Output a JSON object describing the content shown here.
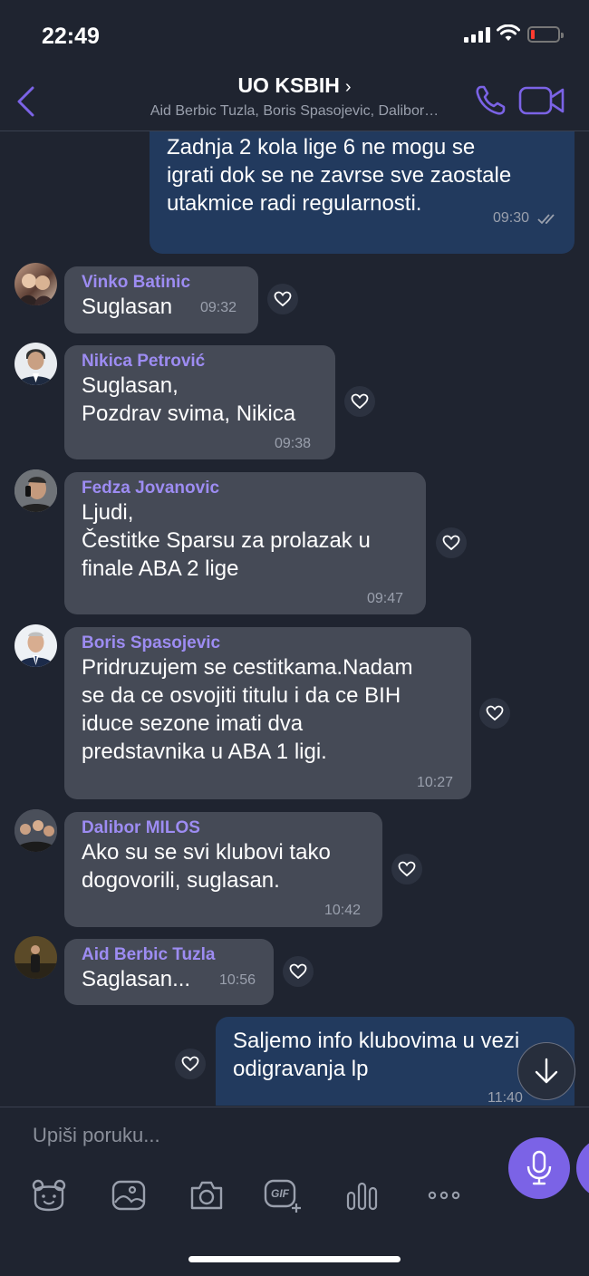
{
  "status_bar": {
    "time": "22:49"
  },
  "header": {
    "title": "UO KSBIH",
    "chevron": "›",
    "subtitle": "Aid Berbic Tuzla, Boris Spasojevic, Dalibor…"
  },
  "messages": [
    {
      "kind": "out",
      "text": "Zadnja 2 kola lige 6 ne mogu se\nigrati dok se ne zavrse sve zaostale\nutakmice radi regularnosti.",
      "time": "09:30"
    },
    {
      "kind": "in",
      "sender": "Vinko Batinic",
      "text": "Suglasan",
      "time": "09:32"
    },
    {
      "kind": "in",
      "sender": "Nikica Petrović",
      "text": "Suglasan,\nPozdrav svima, Nikica",
      "time": "09:38"
    },
    {
      "kind": "in",
      "sender": "Fedza Jovanovic",
      "text": "Ljudi,\nČestitke Sparsu za prolazak u\nfinale ABA 2 lige",
      "time": "09:47"
    },
    {
      "kind": "in",
      "sender": "Boris Spasojevic",
      "text": "Pridruzujem se cestitkama.Nadam\nse da ce osvojiti titulu  i da ce BIH\niduce sezone imati dva\npredstavnika u ABA 1 ligi.",
      "time": "10:27"
    },
    {
      "kind": "in",
      "sender": "Dalibor MILOS",
      "text": "Ako su se svi klubovi tako\ndogovorili, suglasan.",
      "time": "10:42"
    },
    {
      "kind": "in",
      "sender": "Aid Berbic Tuzla",
      "text": "Saglasan...",
      "time": "10:56"
    },
    {
      "kind": "out",
      "text": "Saljemo info klubovima u vezi\nodigravanja lp",
      "time": "11:40"
    }
  ],
  "composer": {
    "placeholder": "Upiši poruku...",
    "toolbar_icons": [
      "sticker-icon",
      "gallery-icon",
      "camera-icon",
      "gif-icon",
      "poll-icon",
      "more-icon"
    ],
    "gif_label": "GIF"
  },
  "colors": {
    "accent": "#7b63e6",
    "sender_name": "#9d8cf2",
    "incoming_bubble": "#454a56",
    "outgoing_bubble": "#223a5e",
    "background": "#1f2430"
  }
}
